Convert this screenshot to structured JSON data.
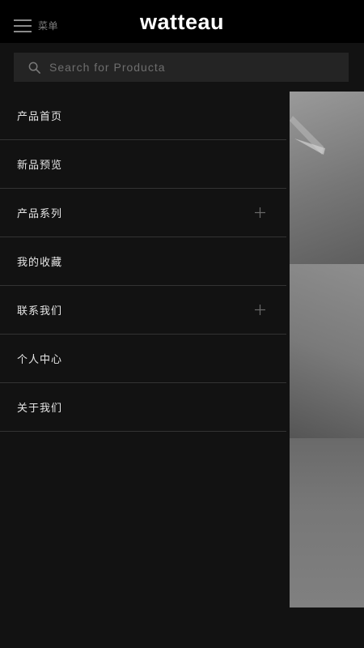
{
  "header": {
    "menu_label": "菜单",
    "logo": "watteau"
  },
  "search": {
    "placeholder": "Search for Producta",
    "value": ""
  },
  "menu": {
    "items": [
      {
        "label": "产品首页",
        "expandable": false
      },
      {
        "label": "新品预览",
        "expandable": false
      },
      {
        "label": "产品系列",
        "expandable": true
      },
      {
        "label": "我的收藏",
        "expandable": false
      },
      {
        "label": "联系我们",
        "expandable": true
      },
      {
        "label": "个人中心",
        "expandable": false
      },
      {
        "label": "关于我们",
        "expandable": false
      }
    ]
  },
  "icons": {
    "menu": "hamburger-icon",
    "search": "search-icon",
    "expand": "plus-icon"
  },
  "colors": {
    "background": "#121212",
    "header": "#000000",
    "search_bg": "#242424",
    "divider": "#333333",
    "text": "#e6e6e6"
  }
}
